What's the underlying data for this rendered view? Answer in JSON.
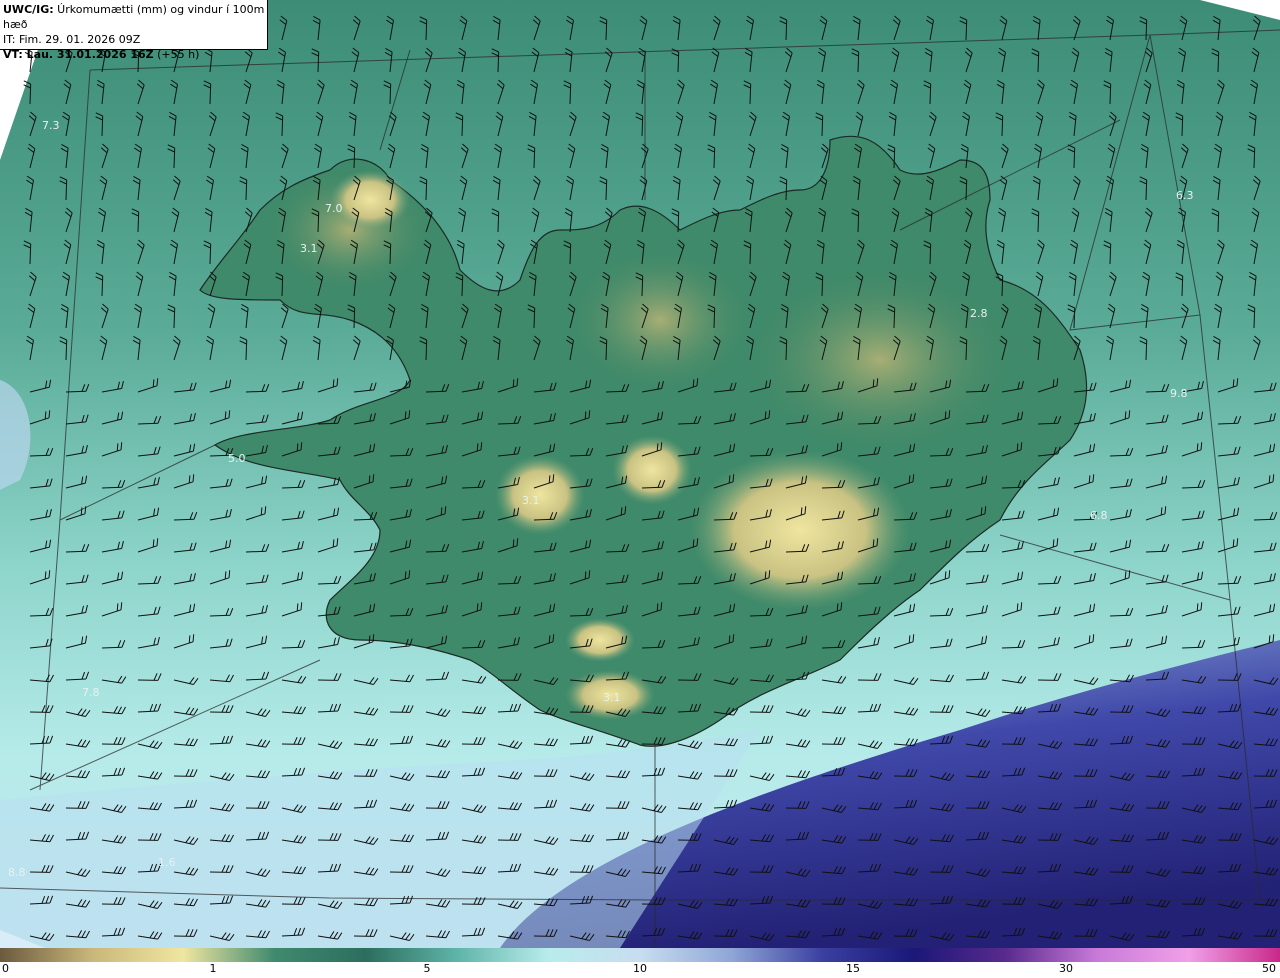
{
  "header": {
    "model": "UWC/IG:",
    "title": " Úrkomumætti (mm) og vindur í 100m hæð",
    "init_time": "IT: Fim. 29. 01. 2026 09Z",
    "valid_label": "VT: Lau. 31.01.2026 16Z",
    "valid_offset": " (+55 h)"
  },
  "map_labels": [
    {
      "text": "7.3"
    },
    {
      "text": "7.0"
    },
    {
      "text": "3.1"
    },
    {
      "text": "6.3"
    },
    {
      "text": "2.8"
    },
    {
      "text": "9.8"
    },
    {
      "text": "5.0"
    },
    {
      "text": "3.1"
    },
    {
      "text": "6.8"
    },
    {
      "text": "7.8"
    },
    {
      "text": "3.1"
    },
    {
      "text": "1.6"
    },
    {
      "text": "8.8"
    }
  ],
  "colorbar": {
    "ticks": [
      "0",
      "1",
      "5",
      "10",
      "15",
      "30",
      "50"
    ],
    "colors": [
      "#6b5a3e",
      "#c9b67a",
      "#f0e6a0",
      "#3f8a6e",
      "#2c6e5e",
      "#5fb4a8",
      "#b8ecec",
      "#c8ddf0",
      "#8fa6d6",
      "#3a3fa0",
      "#1a1878",
      "#5a2a8e",
      "#c87ad8",
      "#f0a0e8",
      "#c8288a"
    ]
  },
  "legend_title": "",
  "icons": {
    "wind_barb": "wind-barb-icon"
  }
}
